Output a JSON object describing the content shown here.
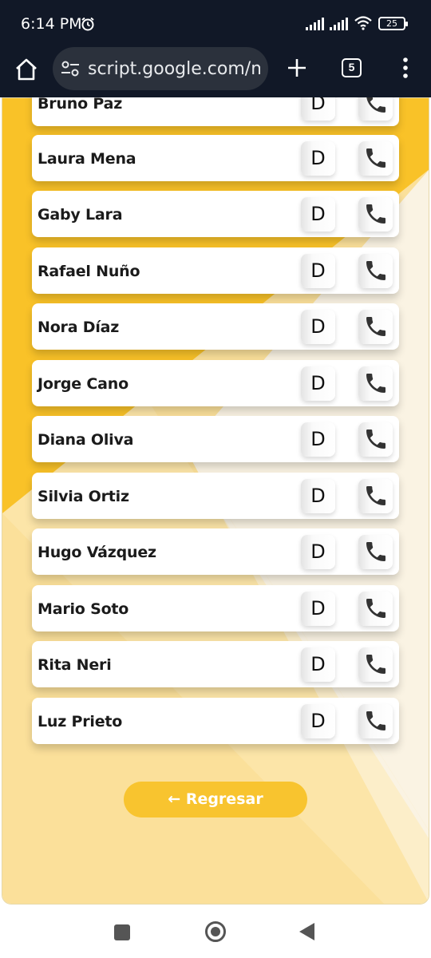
{
  "status_bar": {
    "time": "6:14 PM",
    "battery": "25"
  },
  "browser": {
    "url": "script.google.com/m",
    "tab_count": "5"
  },
  "contacts": [
    {
      "name": "Bruno Paz",
      "action_label": "D"
    },
    {
      "name": "Laura Mena",
      "action_label": "D"
    },
    {
      "name": "Gaby Lara",
      "action_label": "D"
    },
    {
      "name": "Rafael Nuño",
      "action_label": "D"
    },
    {
      "name": "Nora Díaz",
      "action_label": "D"
    },
    {
      "name": "Jorge Cano",
      "action_label": "D"
    },
    {
      "name": "Diana Oliva",
      "action_label": "D"
    },
    {
      "name": "Silvia Ortiz",
      "action_label": "D"
    },
    {
      "name": "Hugo Vázquez",
      "action_label": "D"
    },
    {
      "name": "Mario Soto",
      "action_label": "D"
    },
    {
      "name": "Rita Neri",
      "action_label": "D"
    },
    {
      "name": "Luz Prieto",
      "action_label": "D"
    }
  ],
  "back_button_label": "← Regresar",
  "colors": {
    "accent": "#f8c42f",
    "background_light": "#fbe4a0",
    "background_cream": "#faf3e3"
  },
  "icons": {
    "call": "phone-icon",
    "home": "home-icon",
    "menu": "more-vert-icon"
  }
}
